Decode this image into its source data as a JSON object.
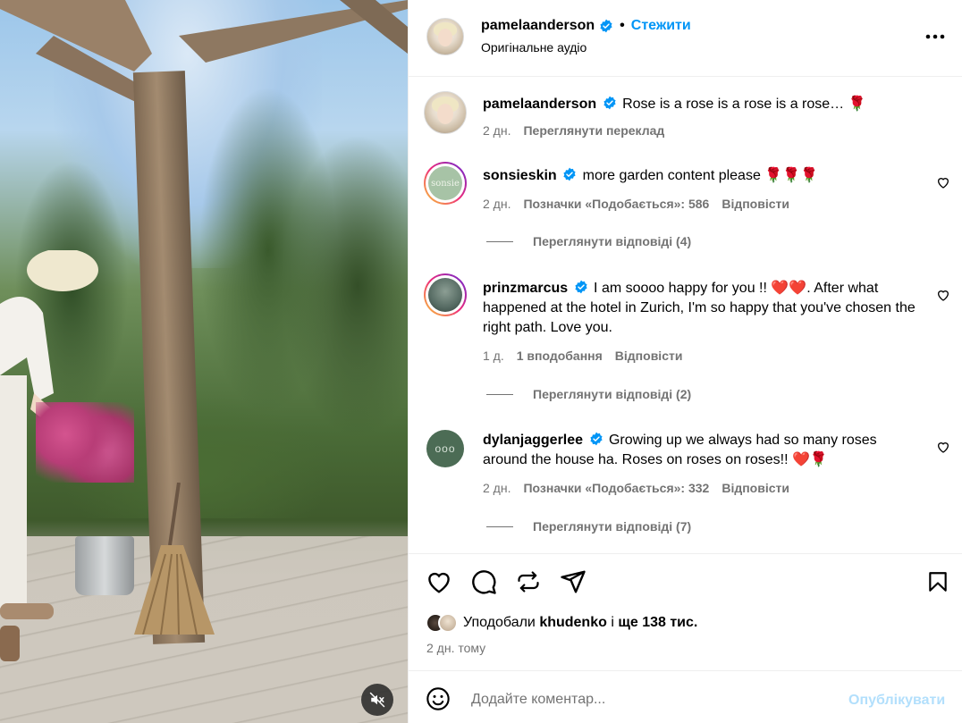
{
  "post": {
    "author": "pamelaanderson",
    "follow_label": "Стежити",
    "dot": "•",
    "audio_label": "Оригінальне аудіо",
    "caption_text": "Rose is a rose is a rose is a rose… 🌹",
    "caption_age": "2 дн.",
    "translate_label": "Переглянути переклад"
  },
  "comments": [
    {
      "username": "sonsieskin",
      "text": "more garden content please 🌹🌹🌹",
      "age": "2 дн.",
      "likes_label": "Позначки «Подобається»: 586",
      "reply_label": "Відповісти",
      "view_replies": "Переглянути відповіді (4)",
      "avatar_text": "sonsie"
    },
    {
      "username": "prinzmarcus",
      "text": "I am soooo happy for you !! ❤️❤️. After what happened at the hotel in Zurich, I'm so happy that you've chosen the right path. Love you.",
      "age": "1 д.",
      "likes_label": "1 вподобання",
      "reply_label": "Відповісти",
      "view_replies": "Переглянути відповіді (2)"
    },
    {
      "username": "dylanjaggerlee",
      "text": "Growing up we always had so many roses around the house ha. Roses on roses on roses!! ❤️🌹",
      "age": "2 дн.",
      "likes_label": "Позначки «Подобається»: 332",
      "reply_label": "Відповісти",
      "view_replies": "Переглянути відповіді (7)",
      "avatar_text": "ooo"
    }
  ],
  "likes": {
    "prefix": "Уподобали",
    "user": "khudenko",
    "connector": "і",
    "rest": "ще 138 тис."
  },
  "post_age": "2 дн. тому",
  "composer": {
    "placeholder": "Додайте коментар...",
    "publish_label": "Опублікувати"
  },
  "icons": {
    "verified": "verified-badge-icon",
    "more": "more-options-icon",
    "like": "heart-icon",
    "comment": "comment-icon",
    "share": "share-icon",
    "save": "bookmark-icon",
    "emoji": "emoji-icon",
    "mute": "muted-speaker-icon"
  },
  "colors": {
    "accent": "#0095f6",
    "publish_disabled": "#b2dffc",
    "secondary_text": "#737373",
    "heart_red": "#ed1c24"
  }
}
